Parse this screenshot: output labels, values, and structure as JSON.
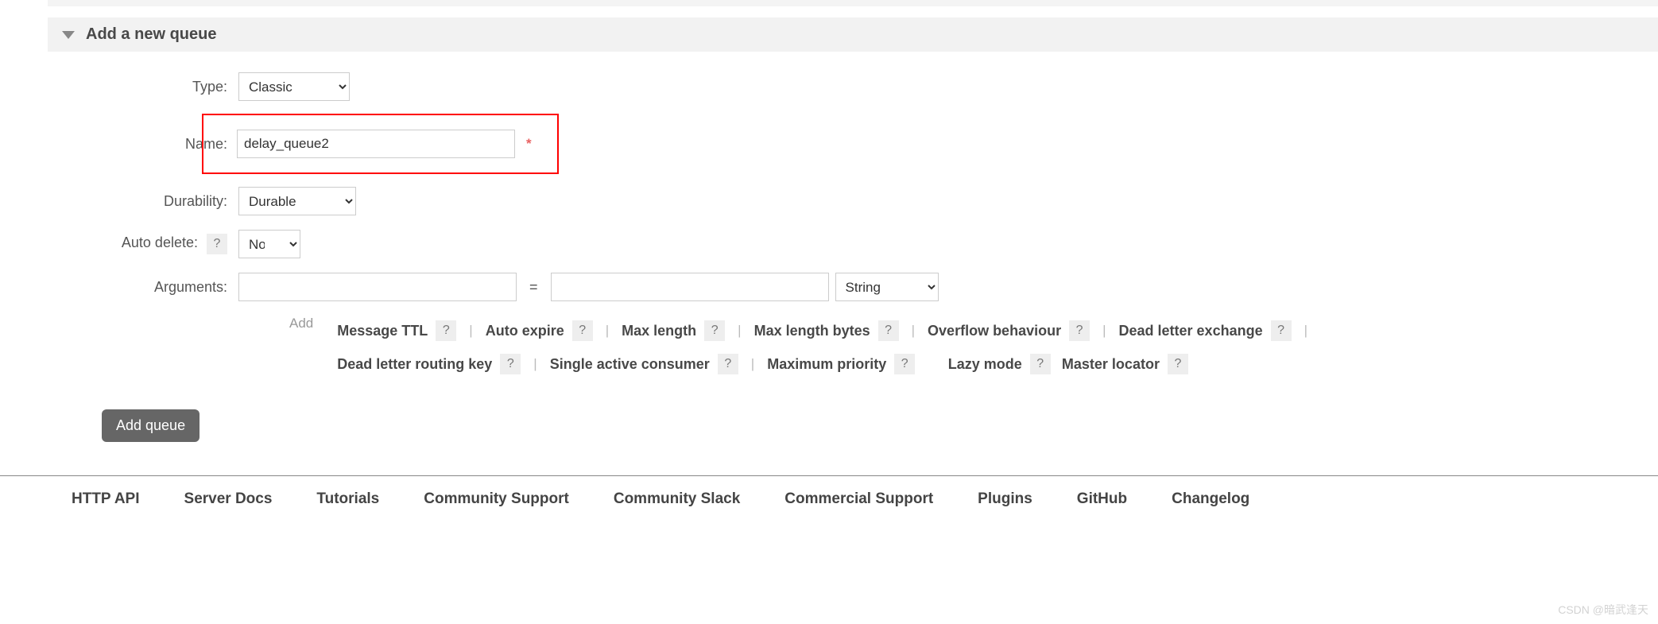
{
  "section": {
    "title": "Add a new queue"
  },
  "form": {
    "type": {
      "label": "Type:",
      "value": "Classic"
    },
    "name": {
      "label": "Name:",
      "value": "delay_queue2",
      "required_marker": "*"
    },
    "durability": {
      "label": "Durability:",
      "value": "Durable"
    },
    "autodelete": {
      "label": "Auto delete:",
      "value": "No"
    },
    "arguments": {
      "label": "Arguments:",
      "key": "",
      "eq": "=",
      "val": "",
      "valtype": "String",
      "add_label": "Add",
      "hints": [
        "Message TTL",
        "Auto expire",
        "Max length",
        "Max length bytes",
        "Overflow behaviour",
        "Dead letter exchange",
        "Dead letter routing key",
        "Single active consumer",
        "Maximum priority",
        "Lazy mode",
        "Master locator"
      ]
    }
  },
  "help_glyph": "?",
  "submit": {
    "label": "Add queue"
  },
  "footer": {
    "links": [
      "HTTP API",
      "Server Docs",
      "Tutorials",
      "Community Support",
      "Community Slack",
      "Commercial Support",
      "Plugins",
      "GitHub",
      "Changelog"
    ]
  },
  "watermark": "CSDN @暗武逢天"
}
